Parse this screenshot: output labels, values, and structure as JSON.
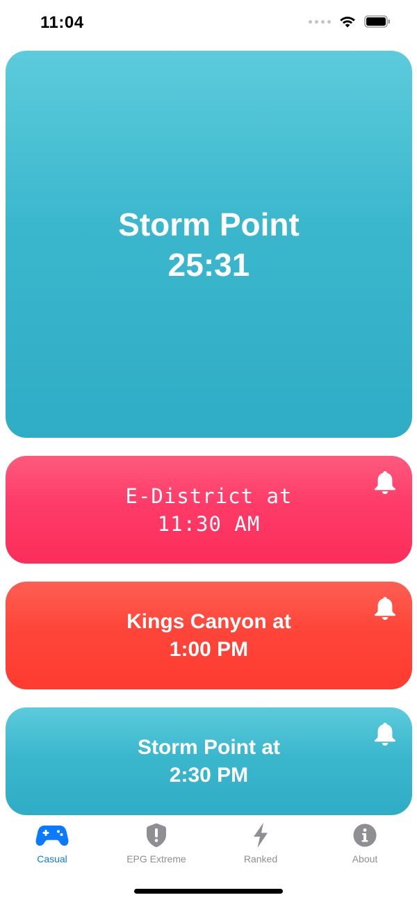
{
  "status_bar": {
    "time": "11:04"
  },
  "main_card": {
    "title": "Storm Point",
    "timer": "25:31",
    "color": "#3bb7cd"
  },
  "upcoming": [
    {
      "line1": "E-District at",
      "line2": "11:30 AM",
      "color": "#fe3b68",
      "icon": "bell-icon"
    },
    {
      "line1": "Kings Canyon at",
      "line2": "1:00 PM",
      "color": "#fe4539",
      "icon": "bell-icon"
    },
    {
      "line1": "Storm Point at",
      "line2": "2:30 PM",
      "color": "#3bb7cd",
      "icon": "bell-icon"
    }
  ],
  "tabs": [
    {
      "label": "Casual",
      "icon": "gamecontroller-icon",
      "active": true
    },
    {
      "label": "EPG Extreme",
      "icon": "shield-exclamation-icon",
      "active": false
    },
    {
      "label": "Ranked",
      "icon": "bolt-icon",
      "active": false
    },
    {
      "label": "About",
      "icon": "info-icon",
      "active": false
    }
  ],
  "colors": {
    "accent": "#0a7aff",
    "inactive_tab": "#8e8e93"
  }
}
